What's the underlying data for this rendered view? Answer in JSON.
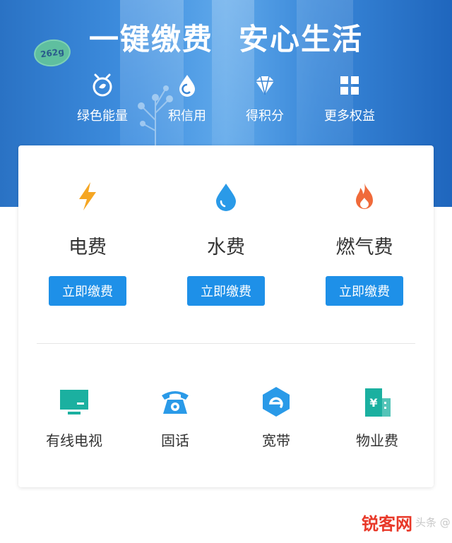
{
  "hero": {
    "sticker": "262g",
    "slogan_left": "一键缴费",
    "slogan_right": "安心生活",
    "perks": [
      {
        "label": "绿色能量",
        "icon": "green-energy-icon"
      },
      {
        "label": "积信用",
        "icon": "credit-icon"
      },
      {
        "label": "得积分",
        "icon": "diamond-points-icon"
      },
      {
        "label": "更多权益",
        "icon": "grid-more-icon"
      }
    ]
  },
  "bills": [
    {
      "name": "电费",
      "button": "立即缴费",
      "icon": "lightning-icon",
      "color": "#f5a623"
    },
    {
      "name": "水费",
      "button": "立即缴费",
      "icon": "water-drop-icon",
      "color": "#2a9ae8"
    },
    {
      "name": "燃气费",
      "button": "立即缴费",
      "icon": "flame-icon",
      "color": "#f06a3a"
    }
  ],
  "services": [
    {
      "name": "有线电视",
      "icon": "tv-icon",
      "color": "#1bb0a0"
    },
    {
      "name": "固话",
      "icon": "telephone-icon",
      "color": "#2a9ae8"
    },
    {
      "name": "宽带",
      "icon": "broadband-icon",
      "color": "#2a9ae8"
    },
    {
      "name": "物业费",
      "icon": "property-building-icon",
      "color": "#1bb0a0"
    }
  ],
  "watermark": {
    "brand": "锐客网",
    "tail": "头条 @"
  },
  "colors": {
    "primary": "#1e90e8",
    "hero": "#2a72c4"
  }
}
